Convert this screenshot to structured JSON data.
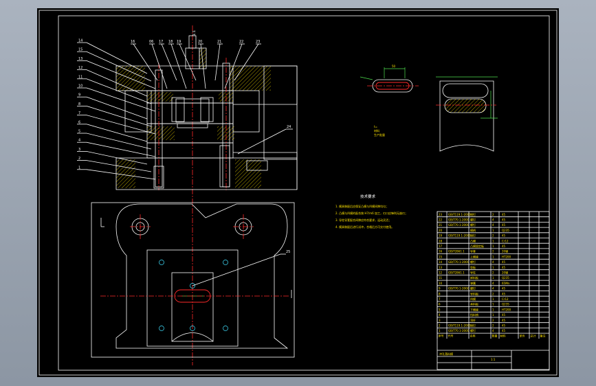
{
  "drawing": {
    "viewport_bg": "#000000",
    "page_bg": "#9aa4b1",
    "colors": {
      "outline": "#ffffff",
      "centerline": "#ff2a2a",
      "hatch": "#ffe400",
      "dim": "#4fe24f",
      "accent": "#40e0ff"
    },
    "section_view": {
      "callouts_left": [
        "14",
        "15",
        "13",
        "12",
        "11",
        "10",
        "9",
        "8",
        "7",
        "6",
        "5",
        "4",
        "3",
        "2",
        "1"
      ],
      "callouts_top": [
        "16",
        "06",
        "17",
        "18",
        "19",
        "20",
        "21",
        "22",
        "23"
      ],
      "callout_right": "24",
      "top_callout": "1:1"
    },
    "plan_view": {
      "callout": "25"
    },
    "part_views": {
      "dim_label": "50",
      "note_lines": [
        "t=",
        "材料",
        "生产批量"
      ]
    },
    "notes": {
      "title": "技术要求",
      "lines": [
        "1. 模具装配后应保证凸模与凹模间隙均匀；",
        "2. 凸模与凹模的配合按 H7/m6 加工，刃口应锋利无崩刃；",
        "3. 导柱导套配合间隙应符合要求，运动灵活；",
        "4. 模具装配后进行试冲，合格后方可交付使用。"
      ]
    },
    "parts_table": {
      "rows": [
        [
          "23",
          "GB/T119.1-2000",
          "销钉",
          "2",
          "45"
        ],
        [
          "22",
          "GB/T70.1-2000",
          "螺钉",
          "4",
          "45"
        ],
        [
          "21",
          "GB/T70.1-2000",
          "螺钉",
          "4",
          "45"
        ],
        [
          "20",
          "",
          "模柄",
          "1",
          "Q235"
        ],
        [
          "19",
          "GB/T119.1-2000",
          "销钉",
          "2",
          "45"
        ],
        [
          "18",
          "",
          "凸模",
          "1",
          "Cr12"
        ],
        [
          "17",
          "",
          "凸模固定板",
          "1",
          "45"
        ],
        [
          "16",
          "GB/T2861.1",
          "导套",
          "2",
          "20钢"
        ],
        [
          "15",
          "",
          "上模座",
          "1",
          "HT200"
        ],
        [
          "14",
          "GB/T70.1-2000",
          "螺钉",
          "4",
          "45"
        ],
        [
          "13",
          "",
          "垫板",
          "1",
          "45"
        ],
        [
          "12",
          "GB/T2861.1",
          "导柱",
          "2",
          "20钢"
        ],
        [
          "11",
          "",
          "卸料板",
          "1",
          "Q235"
        ],
        [
          "10",
          "",
          "弹簧",
          "4",
          "65Mn"
        ],
        [
          "9",
          "GB/T70.1-2000",
          "螺钉",
          "4",
          "45"
        ],
        [
          "8",
          "",
          "导料板",
          "2",
          "45"
        ],
        [
          "7",
          "",
          "凹模",
          "1",
          "Cr12"
        ],
        [
          "6",
          "",
          "承料板",
          "1",
          "Q235"
        ],
        [
          "5",
          "",
          "下模座",
          "1",
          "HT200"
        ],
        [
          "4",
          "",
          "挡料销",
          "1",
          "45"
        ],
        [
          "3",
          "",
          "顶杆",
          "2",
          "45"
        ],
        [
          "2",
          "GB/T119.1-2000",
          "销钉",
          "2",
          "45"
        ],
        [
          "1",
          "GB/T70.1-2000",
          "螺钉",
          "4",
          "45"
        ]
      ],
      "header": [
        "序号",
        "代号",
        "名称",
        "数量",
        "材料",
        "单件",
        "总计",
        "备注"
      ]
    },
    "title_block": {
      "left_top": "冲孔落料模",
      "scale": "1:1"
    }
  }
}
